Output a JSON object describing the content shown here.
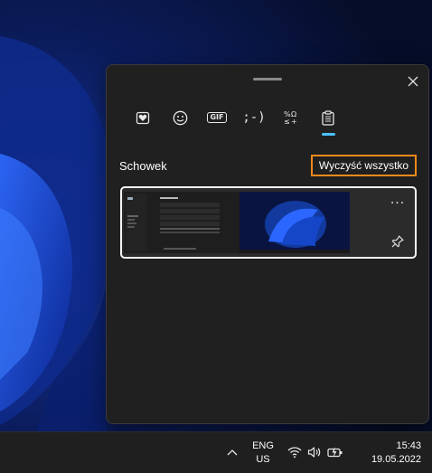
{
  "panel": {
    "tabs": [
      {
        "icon": "favorites-heart-icon"
      },
      {
        "icon": "emoji-icon"
      },
      {
        "icon": "gif-icon",
        "label": "GIF"
      },
      {
        "icon": "kaomoji-icon",
        "label": ";-)"
      },
      {
        "icon": "symbols-icon"
      },
      {
        "icon": "clipboard-icon",
        "active": true
      }
    ],
    "section_title": "Schowek",
    "clear_all_label": "Wyczyść wszystko",
    "clip_item": {
      "more_label": "···"
    },
    "colors": {
      "accent": "#4cc2ff",
      "highlight": "#f28a1b",
      "panel_bg": "#202020"
    }
  },
  "taskbar": {
    "lang_line1": "ENG",
    "lang_line2": "US",
    "time": "15:43",
    "date": "19.05.2022"
  }
}
